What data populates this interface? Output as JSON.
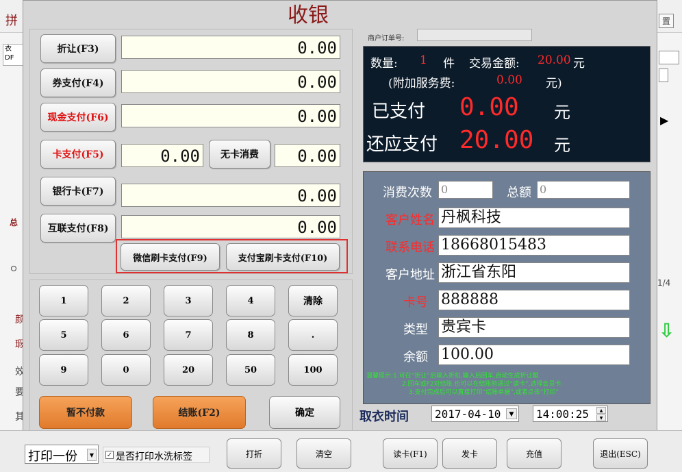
{
  "window": {
    "title": "收银"
  },
  "background": {
    "left_top": "拼",
    "right_top": "置",
    "left_frags": [
      "衣",
      "DF"
    ],
    "left_total": "总",
    "left_misc": [
      "颜",
      "瑕",
      "效",
      "要",
      "其"
    ],
    "page": "1/4"
  },
  "order_no": {
    "label": "商户订单号:",
    "value": ""
  },
  "payments": [
    {
      "label": "折让(F3)",
      "value": "0.00"
    },
    {
      "label": "券支付(F4)",
      "value": "0.00"
    },
    {
      "label": "现金支付(F6)",
      "value": "0.00"
    },
    {
      "label": "卡支付(F5)",
      "value": "0.00"
    },
    {
      "label": "银行卡(F7)",
      "value": "0.00"
    },
    {
      "label": "互联支付(F8)",
      "value": "0.00"
    }
  ],
  "no_card": {
    "label": "无卡消费",
    "value": "0.00"
  },
  "scan": {
    "wechat": "微信刷卡支付(F9)",
    "alipay": "支付宝刷卡支付(F10)"
  },
  "keypad": [
    "1",
    "2",
    "3",
    "4",
    "清除",
    "5",
    "6",
    "7",
    "8",
    ".",
    "9",
    "0",
    "20",
    "50",
    "100"
  ],
  "actions": {
    "hold": "暂不付款",
    "checkout": "结账(F2)",
    "confirm": "确定"
  },
  "summary": {
    "qty_label": "数量:",
    "qty": "1",
    "qty_unit": "件",
    "amount_label": "交易金额:",
    "amount": "20.00",
    "amount_unit": "元",
    "service_label": "(附加服务费:",
    "service": "0.00",
    "service_unit": "元)",
    "paid_label": "已支付",
    "paid": "0.00",
    "paid_unit": "元",
    "due_label": "还应支付",
    "due": "20.00",
    "due_unit": "元"
  },
  "customer": {
    "visits_label": "消费次数",
    "visits": "0",
    "total_label": "总额",
    "total": "0",
    "name_label": "客户姓名",
    "name": "丹枫科技",
    "phone_label": "联系电话",
    "phone": "18668015483",
    "address_label": "客户地址",
    "address": "浙江省东阳",
    "card_label": "卡号",
    "card": "888888",
    "type_label": "类型",
    "type": "贵宾卡",
    "balance_label": "余额",
    "balance": "100.00",
    "tips": [
      "温馨提示:1.可在“折让”后输入折扣,输入后回车,自动生成折让额",
      "2.回车或F2对结账,也可以在结账前通过“读卡”,选择会员卡",
      "3.支付完成后可以直接打印“结账单据”,或者点击“打印”"
    ]
  },
  "pickup": {
    "label": "取衣时间",
    "date": "2017-04-10",
    "time": "14:00:25"
  },
  "bottom": {
    "print_copies": "打印一份",
    "wash_label": "是否打印水洗标签",
    "discount": "打折",
    "clear": "清空",
    "read_card": "读卡(F1)",
    "issue_card": "发卡",
    "recharge": "充值",
    "exit": "退出(ESC)"
  },
  "colors": {
    "accent_red": "#e01010",
    "display_bg": "#0b1b2a",
    "info_bg": "#6f7f95",
    "highlight_border": "#e03030"
  }
}
